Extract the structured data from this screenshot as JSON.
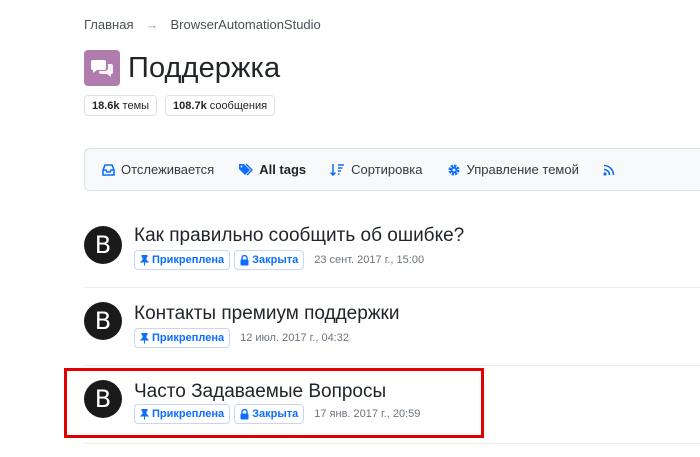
{
  "breadcrumb": {
    "home": "Главная",
    "separator": "→",
    "current": "BrowserAutomationStudio"
  },
  "category": {
    "title": "Поддержка",
    "icon": "chat-bubbles-icon",
    "icon_color": "#b07cae"
  },
  "stats": {
    "topics_count": "18.6k",
    "topics_label": "темы",
    "posts_count": "108.7k",
    "posts_label": "сообщения"
  },
  "toolbar": {
    "watching": "Отслеживается",
    "tags": "All tags",
    "sort": "Сортировка",
    "manage": "Управление темой",
    "rss_icon": "rss-icon"
  },
  "topics": [
    {
      "avatar_letter": "B",
      "title": "Как правильно сообщить об ошибке?",
      "pinned": "Прикреплена",
      "locked": "Закрыта",
      "date": "23 сент. 2017 г., 15:00"
    },
    {
      "avatar_letter": "B",
      "title": "Контакты премиум поддержки",
      "pinned": "Прикреплена",
      "date": "12 июл. 2017 г., 04:32"
    },
    {
      "avatar_letter": "B",
      "title": "Часто Задаваемые Вопросы",
      "pinned": "Прикреплена",
      "locked": "Закрыта",
      "date": "17 янв. 2017 г., 20:59"
    }
  ],
  "colors": {
    "accent": "#0d6efd",
    "highlight": "#e00000"
  }
}
